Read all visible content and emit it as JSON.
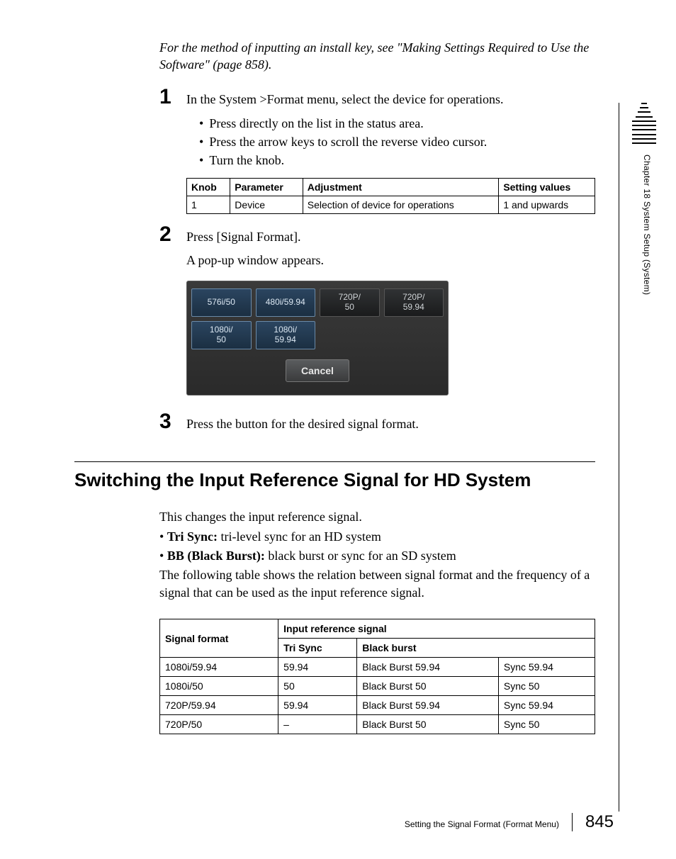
{
  "note": "For the method of inputting an install key, see \"Making Settings Required to Use the Software\" (page 858).",
  "steps": {
    "s1": {
      "num": "1",
      "text": "In the System >Format menu, select the device for operations.",
      "bullets": [
        "Press directly on the list in the status area.",
        "Press the arrow keys to scroll the reverse video cursor.",
        "Turn the knob."
      ]
    },
    "s2": {
      "num": "2",
      "text": "Press [Signal Format].",
      "sub": "A pop-up window appears."
    },
    "s3": {
      "num": "3",
      "text": "Press the button for the desired signal format."
    }
  },
  "param_table": {
    "headers": [
      "Knob",
      "Parameter",
      "Adjustment",
      "Setting values"
    ],
    "row": [
      "1",
      "Device",
      "Selection of device for operations",
      "1 and upwards"
    ]
  },
  "popup": {
    "row1": [
      "576i/50",
      "480i/59.94",
      "720P/\n50",
      "720P/\n59.94"
    ],
    "row2": [
      "1080i/\n50",
      "1080i/\n59.94"
    ],
    "cancel": "Cancel"
  },
  "section": {
    "heading": "Switching the Input Reference Signal for HD System",
    "intro": "This changes the input reference signal.",
    "b1_label": "Tri Sync:",
    "b1_rest": " tri-level sync for an HD system",
    "b2_label": "BB (Black Burst):",
    "b2_rest": " black burst or sync for an SD system",
    "tail": "The following table shows the relation between signal format and the frequency of a signal that can be used as the input reference signal."
  },
  "ref_table": {
    "h_sig": "Signal format",
    "h_input": "Input reference signal",
    "h_tri": "Tri Sync",
    "h_bb": "Black burst",
    "rows": [
      [
        "1080i/59.94",
        "59.94",
        "Black Burst 59.94",
        "Sync 59.94"
      ],
      [
        "1080i/50",
        "50",
        "Black Burst 50",
        "Sync 50"
      ],
      [
        "720P/59.94",
        "59.94",
        "Black Burst 59.94",
        "Sync 59.94"
      ],
      [
        "720P/50",
        "–",
        "Black Burst 50",
        "Sync 50"
      ]
    ]
  },
  "side": "Chapter 18   System Setup (System)",
  "footer": {
    "title": "Setting the Signal Format (Format Menu)",
    "page": "845"
  }
}
